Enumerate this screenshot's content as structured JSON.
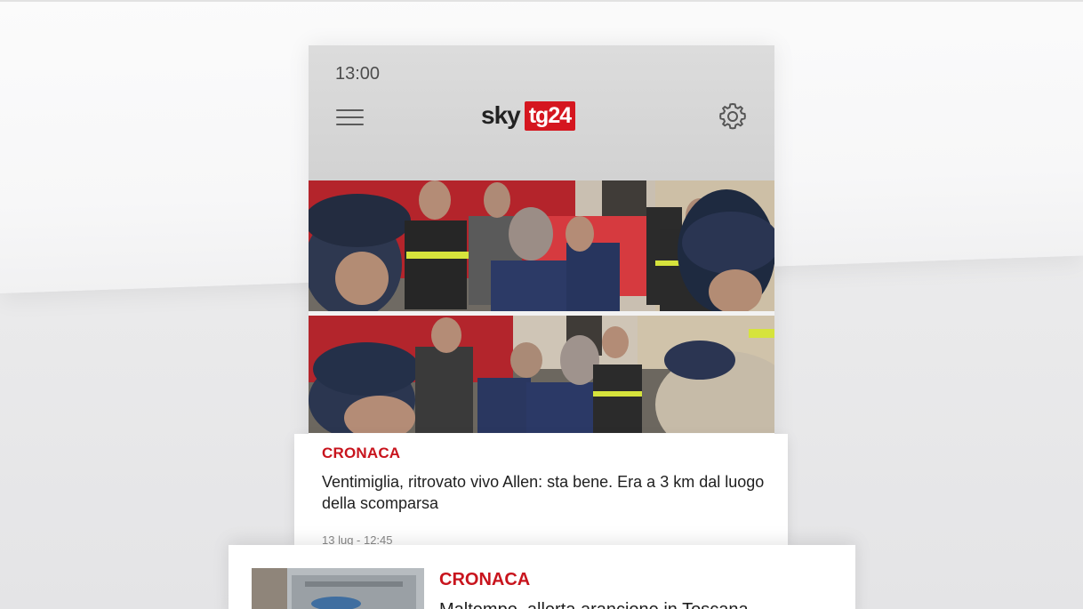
{
  "status_bar": {
    "time": "13:00"
  },
  "header": {
    "menu_icon": "hamburger-menu-icon",
    "logo": {
      "brand": "sky",
      "channel": "tg24",
      "accent": "#d5161f"
    },
    "settings_icon": "gear-icon"
  },
  "featured_article": {
    "category": "CRONACA",
    "title": "Ventimiglia, ritrovato vivo Allen: sta bene. Era a 3 km dal luogo della scomparsa",
    "date": "13 lug - 12:45"
  },
  "next_article": {
    "category": "CRONACA",
    "title": "Maltempo, allerta arancione in Toscana"
  },
  "colors": {
    "category_red": "#c8141d",
    "header_gray": "#d6d6d6"
  }
}
